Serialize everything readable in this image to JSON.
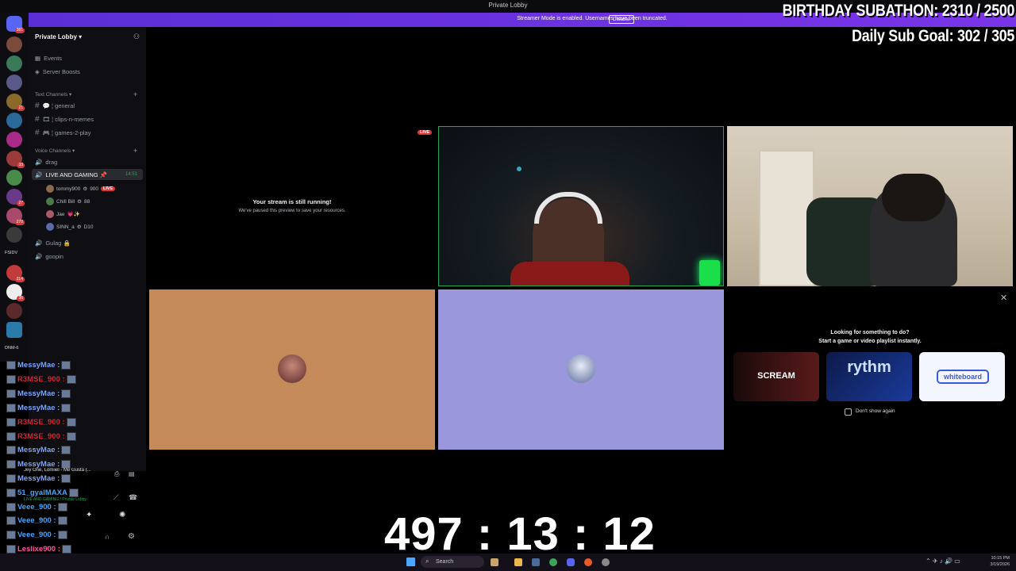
{
  "window": {
    "title": "Private Lobby"
  },
  "banner": {
    "message": "Streamer Mode is enabled. Usernames have been truncated.",
    "button": "Disable"
  },
  "rail": {
    "badges": [
      "381",
      "",
      "",
      "",
      "21",
      "",
      "",
      "",
      "33",
      "",
      "",
      "27",
      "",
      "",
      "270",
      "",
      "",
      "",
      "",
      "",
      "214",
      "",
      "36",
      "",
      ""
    ],
    "labels": [
      "FSIDV",
      "DNM-6"
    ]
  },
  "sidebar": {
    "server_name": "Private Lobby",
    "items": [
      "Events",
      "Server Boosts"
    ],
    "text_category": "Text Channels",
    "text_channels": [
      "general",
      "clips-n-memes",
      "games-2-play"
    ],
    "voice_category": "Voice Channels",
    "voice_channels": [
      "drag",
      "LIVE AND GAMING",
      "Gulag",
      "goopin"
    ],
    "live_channel_time": "14:51",
    "voice_users": [
      {
        "name": "tommy900",
        "tag": "900",
        "live": "LIVE"
      },
      {
        "name": "Chill Bill",
        "tag": "88",
        "live": ""
      },
      {
        "name": "Jae",
        "tag": "",
        "live": ""
      },
      {
        "name": "SINN_a",
        "tag": "D10",
        "live": ""
      }
    ]
  },
  "stage": {
    "paused_title": "Your stream is still running!",
    "paused_sub": "We've paused this preview to save your resources.",
    "live_badge": "LIVE",
    "activity_title": "Looking for something to do?",
    "activity_sub": "Start a game or video playlist instantly.",
    "activities": [
      "SCREAM",
      "rythm",
      "whiteboard"
    ],
    "dont_show": "Don't show again",
    "tile_colors": [
      "#c48a5a",
      "#9a97dd"
    ]
  },
  "overlay": {
    "subathon": "BIRTHDAY SUBATHON:  2310 / 2500",
    "daily_goal": "Daily Sub Goal:  302 / 305",
    "timer": "497 : 13 : 12"
  },
  "chat": [
    {
      "name": "MessyMae :",
      "color": "#7aa8ff"
    },
    {
      "name": "R3MSE_900 :",
      "color": "#e0213a"
    },
    {
      "name": "MessyMae :",
      "color": "#7aa8ff"
    },
    {
      "name": "MessyMae :",
      "color": "#7aa8ff"
    },
    {
      "name": "R3MSE_900 :",
      "color": "#e0213a"
    },
    {
      "name": "R3MSE_900 :",
      "color": "#e0213a"
    },
    {
      "name": "MessyMae :",
      "color": "#7aa8ff"
    },
    {
      "name": "MessyMae :",
      "color": "#7aa8ff"
    },
    {
      "name": "MessyMae :",
      "color": "#7aa8ff"
    },
    {
      "name": "51_gyalMAXA",
      "color": "#3fa7ff"
    },
    {
      "name": "Veee_900 :",
      "color": "#3fa7ff"
    },
    {
      "name": "Veee_900 :",
      "color": "#3fa7ff"
    },
    {
      "name": "Veee_900 :",
      "color": "#3fa7ff"
    },
    {
      "name": "Leslixe900 :",
      "color": "#ff4fa3"
    }
  ],
  "userpanel": {
    "now_playing": "Jey One, Lomiiel - Me Gusta (...",
    "channel": "LIVE AND GAMING / Private Lobby"
  },
  "taskbar": {
    "search": "Search",
    "time": "10:15 PM",
    "date": "3/19/2026"
  }
}
